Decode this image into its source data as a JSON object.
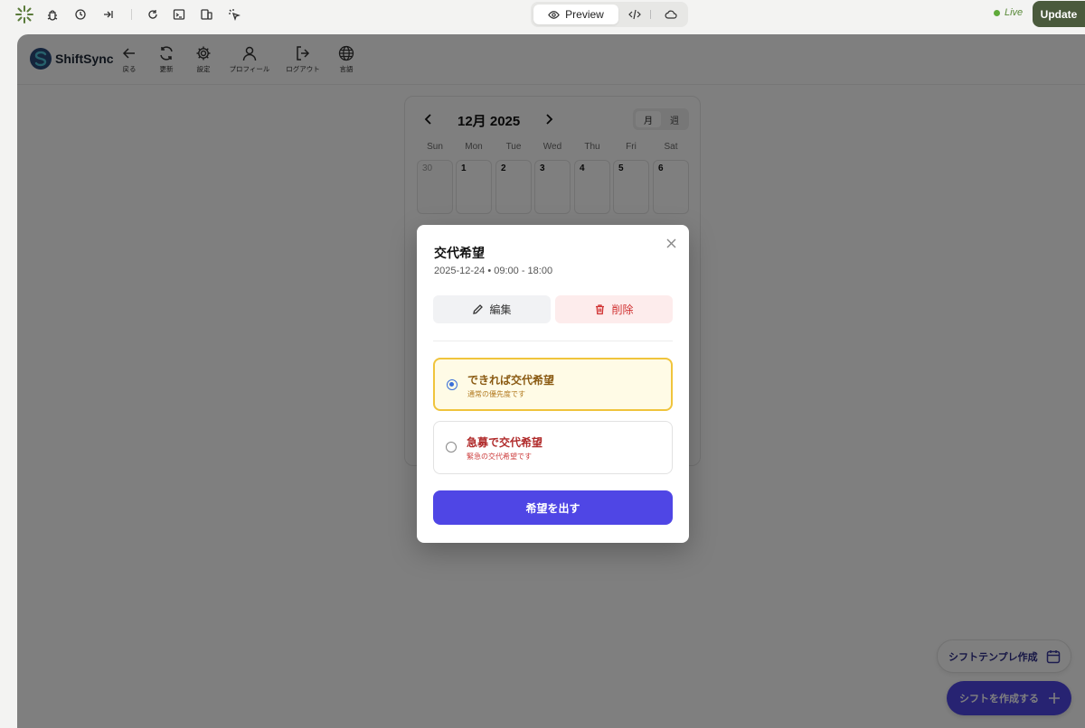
{
  "topbar": {
    "preview_label": "Preview",
    "live_label": "Live",
    "update_label": "Update"
  },
  "app": {
    "logo_text": "ShiftSync",
    "nav": [
      {
        "label": "戻る",
        "icon": "arrow-left-icon"
      },
      {
        "label": "更新",
        "icon": "refresh-icon"
      },
      {
        "label": "設定",
        "icon": "gear-icon"
      },
      {
        "label": "プロフィール",
        "icon": "user-icon"
      },
      {
        "label": "ログアウト",
        "icon": "logout-icon"
      },
      {
        "label": "言語",
        "icon": "globe-icon"
      }
    ]
  },
  "calendar": {
    "title": "12月 2025",
    "view_month": "月",
    "view_week": "週",
    "weekdays": [
      "Sun",
      "Mon",
      "Tue",
      "Wed",
      "Thu",
      "Fri",
      "Sat"
    ],
    "first_row": [
      "30",
      "1",
      "2",
      "3",
      "4",
      "5",
      "6"
    ]
  },
  "fab": {
    "template_label": "シフトテンプレ作成",
    "create_label": "シフトを作成する"
  },
  "modal": {
    "title": "交代希望",
    "subtitle": "2025-12-24 • 09:00 - 18:00",
    "edit_label": "編集",
    "delete_label": "削除",
    "options": [
      {
        "title": "できれば交代希望",
        "desc": "通常の優先度です",
        "selected": true
      },
      {
        "title": "急募で交代希望",
        "desc": "緊急の交代希望です",
        "selected": false
      }
    ],
    "submit_label": "希望を出す"
  },
  "colors": {
    "accent": "#4f46e5",
    "overlay": "rgba(0,0,0,0.5)",
    "selected_border": "#f0c43c",
    "danger": "#d03030"
  }
}
